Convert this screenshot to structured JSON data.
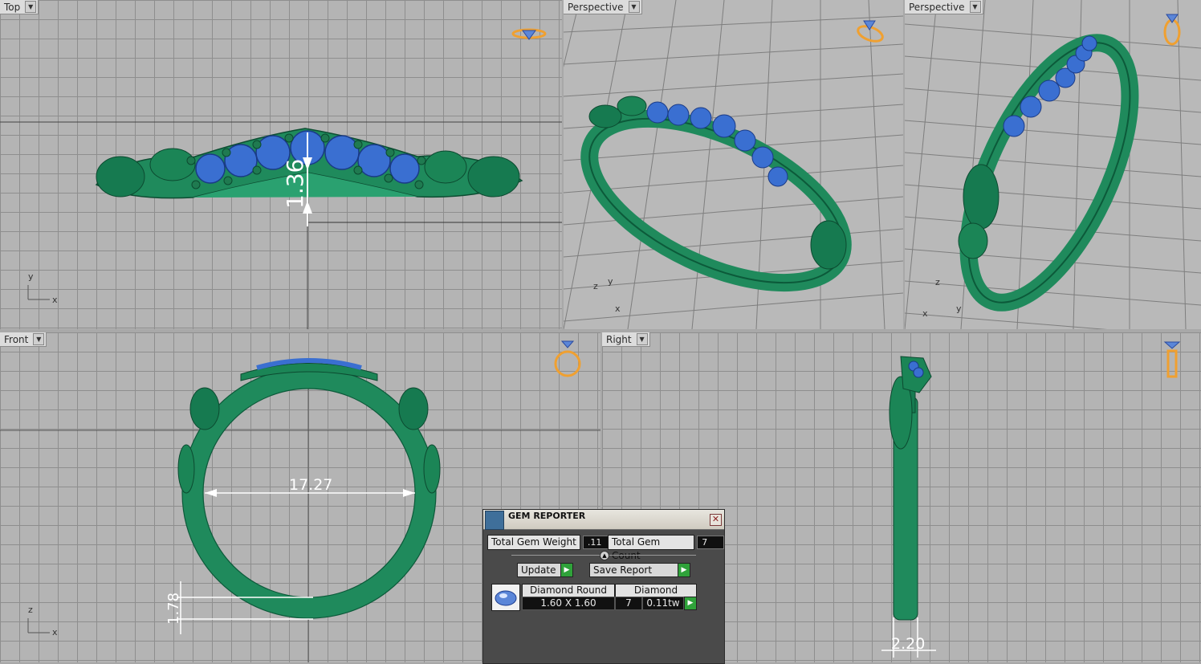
{
  "viewports": {
    "top": {
      "label": "Top",
      "axes": [
        "y",
        "x"
      ],
      "dimension": "1.36"
    },
    "perspective1": {
      "label": "Perspective",
      "axes": [
        "z",
        "y",
        "x"
      ]
    },
    "perspective2": {
      "label": "Perspective",
      "axes": [
        "z",
        "x",
        "y"
      ]
    },
    "front": {
      "label": "Front",
      "axes": [
        "z",
        "x"
      ],
      "dimension_width": "17.27",
      "dimension_thickness": "1.78"
    },
    "right": {
      "label": "Right",
      "dimension": "2.20"
    }
  },
  "gem_reporter": {
    "title": "GEM REPORTER",
    "total_gem_weight_label": "Total Gem Weight",
    "total_gem_weight_value": ".11",
    "total_gem_count_label": "Total Gem Count",
    "total_gem_count_value": "7",
    "update_label": "Update",
    "save_report_label": "Save Report",
    "rows": [
      {
        "cut": "Diamond Round",
        "size": "1.60 X 1.60",
        "material": "Diamond",
        "count": "7",
        "weight": "0.11tw"
      }
    ]
  },
  "colors": {
    "ring": "#1f8a5c",
    "gem": "#3a6fd1",
    "grid_bg": "#b4b4b4",
    "view_icon": "#f0a030"
  }
}
